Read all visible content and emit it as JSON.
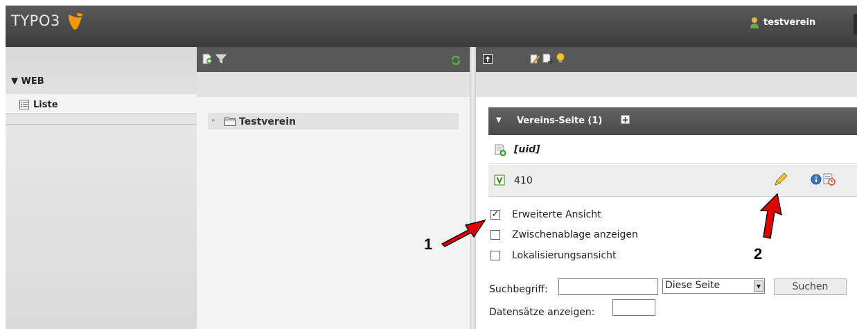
{
  "header": {
    "logo_text": "TYPO3",
    "username": "testverein",
    "logo_color": "#f49800"
  },
  "module_menu": {
    "group_label": "▼ WEB",
    "items": [
      {
        "label": "Liste",
        "icon": "list-icon"
      }
    ]
  },
  "page_tree": {
    "toolbar_icons": [
      "new-page-icon",
      "filter-icon",
      "refresh-icon"
    ],
    "nodes": [
      {
        "label": "Testverein",
        "icon": "folder-icon",
        "expander": "▸"
      }
    ]
  },
  "content": {
    "toolbar_icons": [
      "up-level-icon",
      "edit-page-icon",
      "move-icon",
      "help-bulb-icon"
    ],
    "table": {
      "caret": "▼",
      "title": "Vereins-Seite (1)",
      "add_label": "+",
      "column_header": "[uid]",
      "rows": [
        {
          "uid": "410",
          "icon": "record-v-icon"
        }
      ]
    },
    "options": [
      {
        "label": "Erweiterte Ansicht",
        "checked": true
      },
      {
        "label": "Zwischenablage anzeigen",
        "checked": false
      },
      {
        "label": "Lokalisierungsansicht",
        "checked": false
      }
    ],
    "search": {
      "label": "Suchbegriff:",
      "value": "",
      "scope_value": "Diese Seite",
      "button_label": "Suchen",
      "show_records_label": "Datensätze anzeigen:",
      "show_records_value": ""
    }
  },
  "annotations": {
    "marker_1": "1",
    "marker_2": "2",
    "arrow_color": "#e00000"
  }
}
